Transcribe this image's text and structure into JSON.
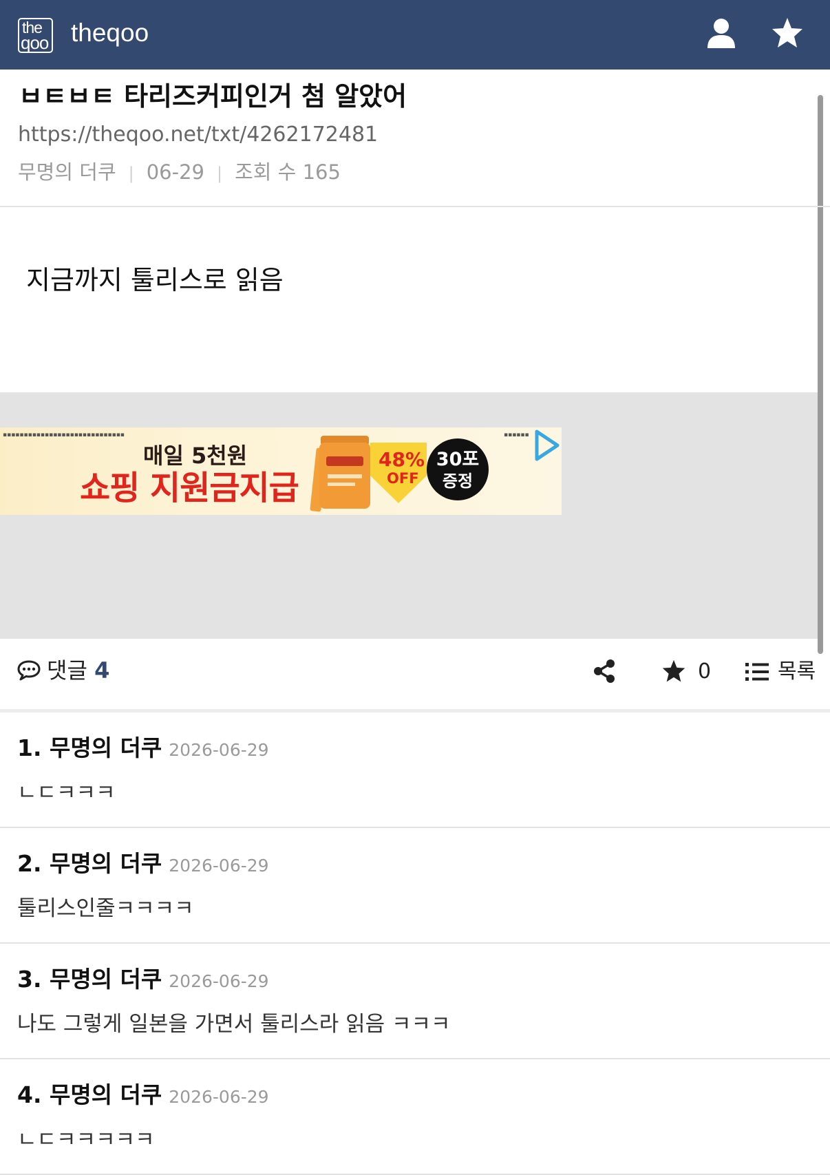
{
  "header": {
    "logo_line1": "the",
    "logo_line2": "qoo",
    "brand": "theqoo",
    "icons": [
      "user-icon",
      "star-icon"
    ]
  },
  "post": {
    "title": "ㅂㅌㅂㅌ 타리즈커피인거 첨 알았어",
    "url": "https://theqoo.net/txt/4262172481",
    "author": "무명의 더쿠",
    "date": "06-29",
    "views": "조회 수 165",
    "body": "지금까지 툴리스로 읽음"
  },
  "ad": {
    "line1": "매일 5천원",
    "line2": "쇼핑 지원금지급",
    "discount": "48%",
    "off": "OFF",
    "badge_line1": "30포",
    "badge_line2": "증정",
    "icon": "ad-play-icon"
  },
  "actions": {
    "comment_label": "댓글",
    "comment_count": "4",
    "favorite_count": "0",
    "list_label": "목록",
    "icons": [
      "comment-icon",
      "share-icon",
      "star-icon",
      "list-icon"
    ]
  },
  "comments": [
    {
      "name": "1. 무명의 더쿠",
      "date": "2026-06-29",
      "text": "ㄴㄷㅋㅋㅋ"
    },
    {
      "name": "2. 무명의 더쿠",
      "date": "2026-06-29",
      "text": "툴리스인줄ㅋㅋㅋㅋ"
    },
    {
      "name": "3. 무명의 더쿠",
      "date": "2026-06-29",
      "text": "나도 그렇게 일본을 가면서 툴리스라 읽음 ㅋㅋㅋ"
    },
    {
      "name": "4. 무명의 더쿠",
      "date": "2026-06-29",
      "text": "ㄴㄷㅋㅋㅋㅋㅋ"
    }
  ],
  "colors": {
    "header_bg": "#34496f",
    "comment_count": "#34496f",
    "ad_red": "#e0251d",
    "ad_zone_bg": "#e3e3e3"
  }
}
